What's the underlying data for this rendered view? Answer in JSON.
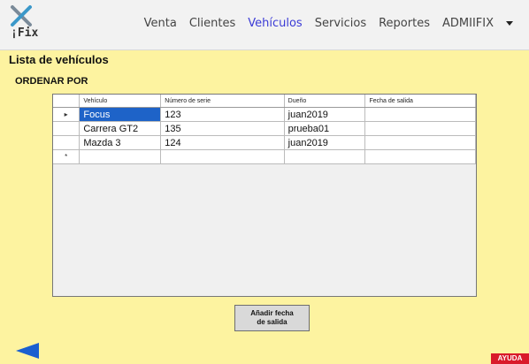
{
  "app": {
    "logo_text": "¡Fix"
  },
  "nav": {
    "items": [
      {
        "label": "Venta"
      },
      {
        "label": "Clientes"
      },
      {
        "label": "Vehículos",
        "active": true
      },
      {
        "label": "Servicios"
      },
      {
        "label": "Reportes"
      }
    ],
    "user_label": "ADMIIFIX"
  },
  "page": {
    "title": "Lista de vehículos",
    "sort_label": "ORDENAR POR"
  },
  "table": {
    "columns": [
      "Vehículo",
      "Número de serie",
      "Dueño",
      "Fecha de salida"
    ],
    "rows": [
      {
        "marker": "▸",
        "vehiculo": "Focus",
        "serie": "123",
        "dueno": "juan2019",
        "fecha": ""
      },
      {
        "marker": "",
        "vehiculo": "Carrera GT2",
        "serie": "135",
        "dueno": "prueba01",
        "fecha": ""
      },
      {
        "marker": "",
        "vehiculo": "Mazda 3",
        "serie": "124",
        "dueno": "juan2019",
        "fecha": ""
      }
    ],
    "new_row_marker": "*"
  },
  "actions": {
    "add_date_line1": "Añadir fecha",
    "add_date_line2": "de salida",
    "help_label": "AYUDA"
  },
  "icons": {
    "logo": "tools-cross-icon",
    "back": "back-arrow-icon",
    "user_menu": "caret-down-icon"
  },
  "colors": {
    "background": "#fdf3a0",
    "selection": "#1e63c8",
    "nav_active": "#3b3bd6",
    "user_label": "#e040a0",
    "help": "#d91a2a",
    "back_arrow": "#1a5fd0"
  }
}
